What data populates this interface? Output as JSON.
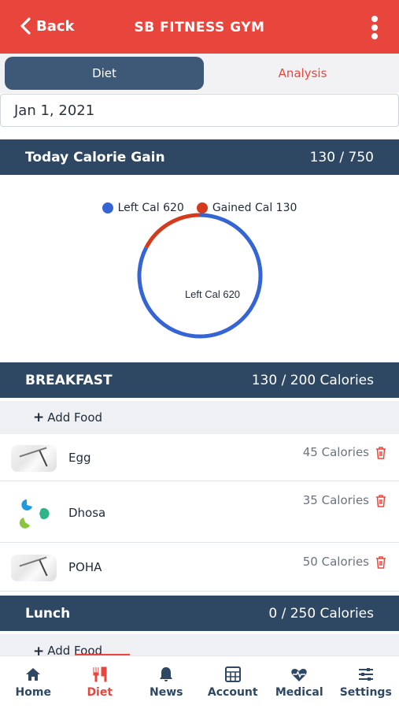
{
  "header": {
    "back_label": "Back",
    "title": "SB FITNESS GYM"
  },
  "tabs": [
    {
      "label": "Diet",
      "active": true
    },
    {
      "label": "Analysis",
      "active": false
    }
  ],
  "date": {
    "value": "Jan 1, 2021"
  },
  "calorie_summary": {
    "title": "Today Calorie Gain",
    "value": "130 / 750"
  },
  "chart_data": {
    "type": "pie",
    "donut": true,
    "slices": [
      {
        "label": "Left Cal",
        "value": 620,
        "color": "#3565d4"
      },
      {
        "label": "Gained Cal",
        "value": 130,
        "color": "#d43a1c"
      }
    ],
    "legend": [
      "Left Cal 620",
      "Gained Cal 130"
    ],
    "center_label": "Left Cal 620",
    "legend_position": "top"
  },
  "breakfast": {
    "title": "BREAKFAST",
    "value": "130 / 200 Calories",
    "add_label": "Add Food",
    "items": [
      {
        "name": "Egg",
        "calories": "45 Calories"
      },
      {
        "name": "Dhosa",
        "calories": "35 Calories"
      },
      {
        "name": "POHA",
        "calories": "50 Calories"
      }
    ]
  },
  "lunch": {
    "title": "Lunch",
    "value": "0 / 250 Calories",
    "add_label": "Add Food"
  },
  "colors": {
    "brand_red": "#e8463d",
    "navy": "#2e4763",
    "tab_blue": "#3e5878"
  },
  "nav": [
    {
      "label": "Home",
      "icon": "home-icon"
    },
    {
      "label": "Diet",
      "icon": "diet-icon",
      "active": true
    },
    {
      "label": "News",
      "icon": "bell-icon"
    },
    {
      "label": "Account",
      "icon": "calculator-icon"
    },
    {
      "label": "Medical",
      "icon": "heartbeat-icon"
    },
    {
      "label": "Settings",
      "icon": "sliders-icon"
    }
  ]
}
